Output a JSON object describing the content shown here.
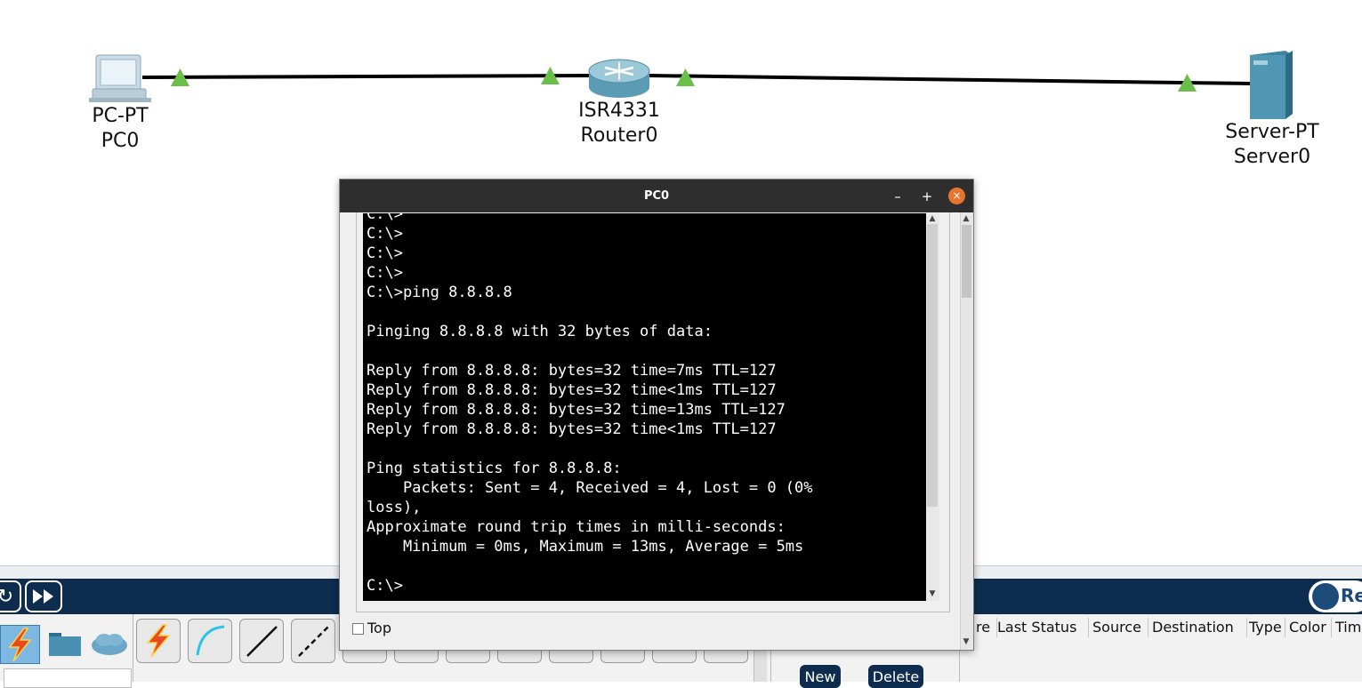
{
  "topology": {
    "devices": [
      {
        "model": "PC-PT",
        "name": "PC0",
        "icon": "pc-icon"
      },
      {
        "model": "ISR4331",
        "name": "Router0",
        "icon": "router-icon"
      },
      {
        "model": "Server-PT",
        "name": "Server0",
        "icon": "server-icon"
      }
    ],
    "link_color": "#000000",
    "link_status_color": "#6abf4b"
  },
  "terminal": {
    "title": "PC0",
    "minimize": "–",
    "maximize": "+",
    "close": "×",
    "lines": [
      "C:\\>",
      "C:\\>",
      "C:\\>",
      "C:\\>",
      "C:\\>ping 8.8.8.8",
      "",
      "Pinging 8.8.8.8 with 32 bytes of data:",
      "",
      "Reply from 8.8.8.8: bytes=32 time=7ms TTL=127",
      "Reply from 8.8.8.8: bytes=32 time<1ms TTL=127",
      "Reply from 8.8.8.8: bytes=32 time=13ms TTL=127",
      "Reply from 8.8.8.8: bytes=32 time<1ms TTL=127",
      "",
      "Ping statistics for 8.8.8.8:",
      "    Packets: Sent = 4, Received = 4, Lost = 0 (0%",
      "loss),",
      "Approximate round trip times in milli-seconds:",
      "    Minimum = 0ms, Maximum = 13ms, Average = 5ms",
      "",
      "C:\\>"
    ],
    "top_checkbox_label": "Top"
  },
  "bottom_panel": {
    "realtime_label": "Re",
    "pdu_columns": [
      "re",
      "Last Status",
      "Source",
      "Destination",
      "Type",
      "Color",
      "Tim"
    ],
    "new_button": "New",
    "delete_button": "Delete",
    "bar_color": "#0e2c4e"
  }
}
